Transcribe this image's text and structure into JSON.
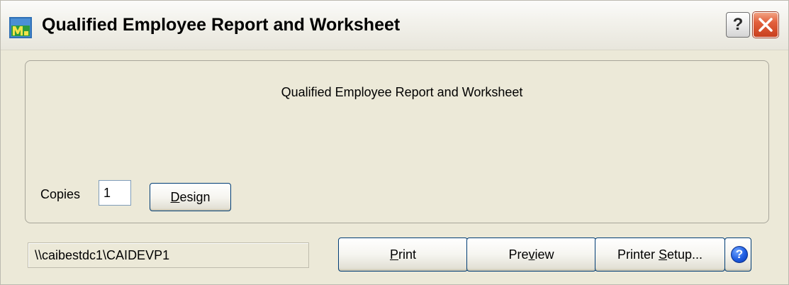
{
  "window": {
    "title": "Qualified Employee Report and Worksheet",
    "help_glyph": "?",
    "close_icon": "close-icon",
    "app_icon": "mas90-app-icon"
  },
  "report": {
    "heading": "Qualified Employee Report and Worksheet",
    "copies_label": "Copies",
    "copies_value": "1",
    "design_button": {
      "prefix": "",
      "accel": "D",
      "suffix": "esign"
    }
  },
  "footer": {
    "printer_path": "\\\\caibestdc1\\CAIDEVP1",
    "print_button": {
      "prefix": "",
      "accel": "P",
      "suffix": "rint"
    },
    "preview_button": {
      "prefix": "Pre",
      "accel": "v",
      "suffix": "iew"
    },
    "setup_button": {
      "prefix": "Printer ",
      "accel": "S",
      "suffix": "etup..."
    },
    "help_button_glyph": "?"
  },
  "colors": {
    "window_bg": "#ece9d8",
    "button_border": "#003c74",
    "close_red": "#e2603c",
    "help_blue": "#1e5ce0"
  }
}
